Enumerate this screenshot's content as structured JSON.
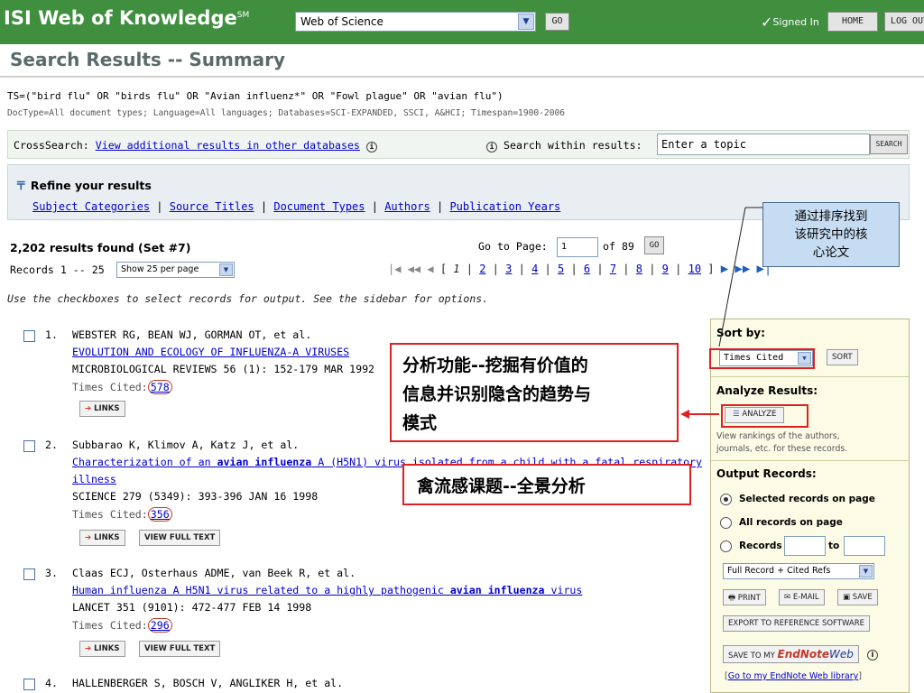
{
  "header": {
    "logo": "ISI Web of Knowledge",
    "logo_mark": "SM",
    "database": "Web of Science",
    "go": "GO",
    "signed_in": "Signed In",
    "home": "HOME",
    "logout": "LOG OUT"
  },
  "page_title": "Search Results -- Summary",
  "query": {
    "ts": "TS=(\"bird flu\" OR \"birds flu\" OR \"Avian influenz*\" OR \"Fowl plague\" OR \"avian flu\")",
    "meta": "DocType=All document types; Language=All languages; Databases=SCI-EXPANDED, SSCI, A&HCI; Timespan=1900-2006"
  },
  "crosssearch": {
    "label": "CrossSearch:",
    "link": "View additional results in other databases",
    "within_label": "Search within results:",
    "topic_placeholder": "Enter a topic",
    "search_button": "SEARCH"
  },
  "refine": {
    "title": "Refine your results",
    "links": [
      "Subject Categories",
      "Source Titles",
      "Document Types",
      "Authors",
      "Publication Years"
    ]
  },
  "results": {
    "found": "2,202 results found (Set #7)",
    "records": "Records 1 -- 25",
    "per_page": "Show 25 per page",
    "goto_label": "Go to Page:",
    "page_value": "1",
    "of_pages": "of 89",
    "go": "GO",
    "pages": [
      "1",
      "2",
      "3",
      "4",
      "5",
      "6",
      "7",
      "8",
      "9",
      "10"
    ]
  },
  "instructions": "Use the checkboxes to select records for output. See the sidebar for options.",
  "records": [
    {
      "num": "1.",
      "authors": "WEBSTER RG, BEAN WJ, GORMAN OT, et al.",
      "title_a": "EVOLUTION AND ECOLOGY OF INFLUENZA-A VIRUSES",
      "source": "MICROBIOLOGICAL REVIEWS 56 (1): 152-179 MAR 1992",
      "times_cited_label": "Times Cited:",
      "times_cited": "578",
      "links": "LINKS"
    },
    {
      "num": "2.",
      "authors": "Subbarao K, Klimov A, Katz J, et al.",
      "title_a": "Characterization of an ",
      "title_b": "avian influenza",
      "title_c": " A (H5N1) virus isolated from a child with a fatal respiratory",
      "title_d": "illness",
      "source": "SCIENCE 279 (5349): 393-396 JAN 16 1998",
      "times_cited_label": "Times Cited:",
      "times_cited": "356",
      "links": "LINKS",
      "full_text": "VIEW FULL TEXT"
    },
    {
      "num": "3.",
      "authors": "Claas ECJ, Osterhaus ADME, van Beek R, et al.",
      "title_a": "Human influenza A H5N1 virus related to a highly pathogenic ",
      "title_b": "avian influenza",
      "title_c": " virus",
      "source": "LANCET 351 (9101): 472-477 FEB 14 1998",
      "times_cited_label": "Times Cited:",
      "times_cited": "296",
      "links": "LINKS",
      "full_text": "VIEW FULL TEXT"
    },
    {
      "num": "4.",
      "authors": "HALLENBERGER S, BOSCH V, ANGLIKER H, et al."
    }
  ],
  "sidebar": {
    "sort_by": "Sort by:",
    "sort_value": "Times Cited",
    "sort_button": "SORT",
    "analyze_title": "Analyze Results:",
    "analyze_button": "ANALYZE",
    "analyze_desc_1": "View rankings of the authors,",
    "analyze_desc_2": "journals, etc. for these records.",
    "output_title": "Output Records:",
    "opt_selected": "Selected records on page",
    "opt_all": "All records on page",
    "opt_records": "Records",
    "opt_to": "to",
    "format": "Full Record + Cited Refs",
    "print": "PRINT",
    "email": "E-MAIL",
    "save": "SAVE",
    "export": "EXPORT TO REFERENCE SOFTWARE",
    "save_to_my": "SAVE TO MY",
    "endnote": "EndNote",
    "web": "Web",
    "endnote_link": "Go to my EndNote Web library"
  },
  "annotations": {
    "analysis": [
      "分析功能--挖掘有价值的",
      "信息并识别隐含的趋势与",
      "模式"
    ],
    "panorama": "禽流感课题--全景分析",
    "callout": [
      "通过排序找到",
      "该研究中的核",
      "心论文"
    ]
  },
  "colors": {
    "header_green": "#3f8f3f",
    "annotation_red": "#e02020",
    "callout_blue": "#c6dcf2",
    "link_blue": "#0000cc"
  }
}
